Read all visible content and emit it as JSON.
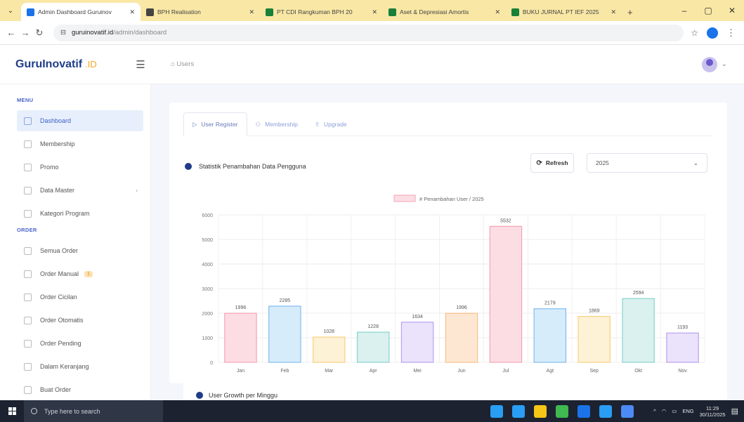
{
  "browser": {
    "tabs": [
      {
        "title": "Admin Dashboard Guruinov",
        "active": true,
        "color": "#1a73e8"
      },
      {
        "title": "BPH Realisation",
        "active": false,
        "color": "#444444"
      },
      {
        "title": "PT CDI Rangkuman BPH 20",
        "active": false,
        "color": "#188038"
      },
      {
        "title": "Aset & Depresiasi Amortis",
        "active": false,
        "color": "#188038"
      },
      {
        "title": "BUKU JURNAL PT IEF 2025",
        "active": false,
        "color": "#188038"
      }
    ],
    "new_tab": "+",
    "url_host": "guruinovatif.id",
    "url_path": "/admin/dashboard"
  },
  "app": {
    "brand": "GuruInovatif",
    "brand_suffix": ".ID",
    "breadcrumb": "Users"
  },
  "sidebar": {
    "menu_label": "MENU",
    "menu_items": [
      {
        "label": "Dashboard",
        "active": true
      },
      {
        "label": "Membership"
      },
      {
        "label": "Promo"
      },
      {
        "label": "Data Master",
        "chevron": "›"
      },
      {
        "label": "Kategori Program"
      }
    ],
    "order_label": "ORDER",
    "order_items": [
      {
        "label": "Semua Order"
      },
      {
        "label": "Order Manual",
        "badge": "1"
      },
      {
        "label": "Order Cicilan"
      },
      {
        "label": "Order Otomatis"
      },
      {
        "label": "Order Pending"
      },
      {
        "label": "Dalam Keranjang"
      },
      {
        "label": "Buat Order"
      }
    ]
  },
  "main": {
    "tabs": [
      "User Register",
      "Membership",
      "Upgrade"
    ],
    "tab_icons": [
      "▷",
      "⚇",
      "⇧"
    ],
    "chart_title": "Statistik Penambahan Data Pengguna",
    "refresh_label": "Refresh",
    "refresh_icon": "⟳",
    "year_value": "2025",
    "second_card_title": "User Growth per Minggu"
  },
  "chart_data": {
    "type": "bar",
    "legend": "# Penambahan User / 2025",
    "legend_position": "top",
    "categories": [
      "Jan",
      "Feb",
      "Mar",
      "Apr",
      "Mei",
      "Jun",
      "Jul",
      "Agt",
      "Sep",
      "Okt",
      "Nov"
    ],
    "values": [
      1996,
      2285,
      1028,
      1228,
      1634,
      1996,
      5532,
      2179,
      1869,
      2594,
      1193
    ],
    "y_ticks": [
      0,
      1000,
      2000,
      3000,
      4000,
      5000,
      6000
    ],
    "ylim": [
      0,
      6000
    ],
    "grid": true,
    "fills": [
      "#fcdde3",
      "#d7ecfb",
      "#fdf1d6",
      "#daf1f0",
      "#ebe2fb",
      "#fde7d2",
      "#fcdde3",
      "#d7ecfb",
      "#fdf1d6",
      "#daf1f0",
      "#ebe2fb"
    ],
    "strokes": [
      "#f6a3b5",
      "#7fbcef",
      "#f8d27f",
      "#88d3cf",
      "#b9a1f0",
      "#f9c08a",
      "#f6a3b5",
      "#7fbcef",
      "#f8d27f",
      "#88d3cf",
      "#b9a1f0"
    ]
  },
  "taskbar": {
    "search_placeholder": "Type here to search",
    "lang": "ENG",
    "time": "11:29",
    "date": "30/11/2025",
    "icon_colors": [
      "#2a9df4",
      "#2a9df4",
      "#f5c518",
      "#3fb950",
      "#1a73e8",
      "#2a9df4",
      "#4c8bf5"
    ]
  }
}
